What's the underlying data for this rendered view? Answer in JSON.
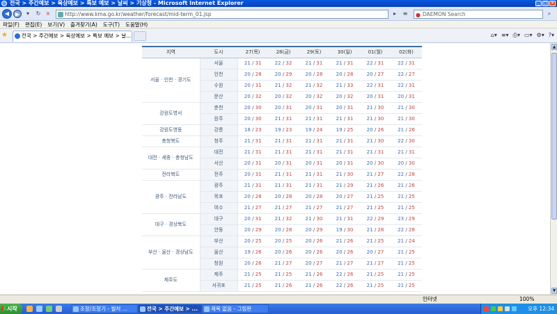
{
  "window": {
    "title": "전국 > 주간예보 > 육상예보 > 특보 예보 > 날씨 > 기상청 - Microsoft Internet Explorer"
  },
  "address": {
    "url": "http://www.kma.go.kr/weather/forecast/mid-term_01.jsp",
    "search_placeholder": "DAEMON Search"
  },
  "menu": [
    "파일(F)",
    "편집(E)",
    "보기(V)",
    "즐겨찾기(A)",
    "도구(T)",
    "도움말(H)"
  ],
  "tab": {
    "title": "전국 > 주간예보 > 육상예보 > 특보 예보 > 날..."
  },
  "table": {
    "headers": [
      "지역",
      "도시",
      "27(목)",
      "28(금)",
      "29(토)",
      "30(일)",
      "01(월)",
      "02(화)"
    ],
    "groups": [
      {
        "region": "서울 · 인천 · 경기도",
        "rows": [
          {
            "city": "서울",
            "temps": [
              [
                "21",
                "31"
              ],
              [
                "22",
                "32"
              ],
              [
                "21",
                "31"
              ],
              [
                "21",
                "31"
              ],
              [
                "22",
                "31"
              ],
              [
                "22",
                "31"
              ]
            ]
          },
          {
            "city": "인천",
            "temps": [
              [
                "20",
                "28"
              ],
              [
                "20",
                "29"
              ],
              [
                "20",
                "28"
              ],
              [
                "20",
                "28"
              ],
              [
                "20",
                "27"
              ],
              [
                "22",
                "27"
              ]
            ]
          },
          {
            "city": "수원",
            "temps": [
              [
                "20",
                "31"
              ],
              [
                "21",
                "32"
              ],
              [
                "21",
                "32"
              ],
              [
                "21",
                "33"
              ],
              [
                "22",
                "31"
              ],
              [
                "22",
                "31"
              ]
            ]
          },
          {
            "city": "문산",
            "temps": [
              [
                "20",
                "32"
              ],
              [
                "20",
                "32"
              ],
              [
                "20",
                "32"
              ],
              [
                "20",
                "32"
              ],
              [
                "20",
                "31"
              ],
              [
                "20",
                "31"
              ]
            ]
          }
        ]
      },
      {
        "region": "강원도영서",
        "rows": [
          {
            "city": "춘천",
            "temps": [
              [
                "20",
                "30"
              ],
              [
                "20",
                "31"
              ],
              [
                "20",
                "31"
              ],
              [
                "20",
                "31"
              ],
              [
                "21",
                "30"
              ],
              [
                "21",
                "30"
              ]
            ]
          },
          {
            "city": "원주",
            "temps": [
              [
                "20",
                "30"
              ],
              [
                "21",
                "31"
              ],
              [
                "21",
                "31"
              ],
              [
                "21",
                "31"
              ],
              [
                "21",
                "30"
              ],
              [
                "21",
                "30"
              ]
            ]
          }
        ]
      },
      {
        "region": "강원도영동",
        "rows": [
          {
            "city": "강릉",
            "temps": [
              [
                "18",
                "23"
              ],
              [
                "19",
                "23"
              ],
              [
                "19",
                "24"
              ],
              [
                "19",
                "25"
              ],
              [
                "20",
                "26"
              ],
              [
                "21",
                "26"
              ]
            ]
          }
        ]
      },
      {
        "region": "충청북도",
        "rows": [
          {
            "city": "청주",
            "temps": [
              [
                "21",
                "31"
              ],
              [
                "21",
                "31"
              ],
              [
                "21",
                "31"
              ],
              [
                "21",
                "31"
              ],
              [
                "21",
                "30"
              ],
              [
                "22",
                "30"
              ]
            ]
          }
        ]
      },
      {
        "region": "대전 · 세종 · 충청남도",
        "rows": [
          {
            "city": "대전",
            "temps": [
              [
                "21",
                "31"
              ],
              [
                "21",
                "31"
              ],
              [
                "21",
                "31"
              ],
              [
                "21",
                "31"
              ],
              [
                "21",
                "31"
              ],
              [
                "21",
                "31"
              ]
            ]
          },
          {
            "city": "서산",
            "temps": [
              [
                "20",
                "31"
              ],
              [
                "20",
                "31"
              ],
              [
                "20",
                "31"
              ],
              [
                "20",
                "31"
              ],
              [
                "20",
                "30"
              ],
              [
                "20",
                "30"
              ]
            ]
          }
        ]
      },
      {
        "region": "전라북도",
        "rows": [
          {
            "city": "전주",
            "temps": [
              [
                "20",
                "31"
              ],
              [
                "21",
                "31"
              ],
              [
                "21",
                "31"
              ],
              [
                "21",
                "30"
              ],
              [
                "21",
                "27"
              ],
              [
                "22",
                "28"
              ]
            ]
          }
        ]
      },
      {
        "region": "광주 · 전라남도",
        "rows": [
          {
            "city": "광주",
            "temps": [
              [
                "21",
                "31"
              ],
              [
                "21",
                "31"
              ],
              [
                "21",
                "31"
              ],
              [
                "21",
                "29"
              ],
              [
                "21",
                "26"
              ],
              [
                "21",
                "26"
              ]
            ]
          },
          {
            "city": "목포",
            "temps": [
              [
                "20",
                "28"
              ],
              [
                "20",
                "28"
              ],
              [
                "20",
                "28"
              ],
              [
                "20",
                "27"
              ],
              [
                "21",
                "25"
              ],
              [
                "21",
                "25"
              ]
            ]
          },
          {
            "city": "여수",
            "temps": [
              [
                "21",
                "27"
              ],
              [
                "21",
                "27"
              ],
              [
                "21",
                "27"
              ],
              [
                "21",
                "27"
              ],
              [
                "21",
                "25"
              ],
              [
                "21",
                "25"
              ]
            ]
          }
        ]
      },
      {
        "region": "대구 · 경상북도",
        "rows": [
          {
            "city": "대구",
            "temps": [
              [
                "20",
                "31"
              ],
              [
                "21",
                "32"
              ],
              [
                "21",
                "30"
              ],
              [
                "21",
                "31"
              ],
              [
                "22",
                "29"
              ],
              [
                "23",
                "29"
              ]
            ]
          },
          {
            "city": "안동",
            "temps": [
              [
                "20",
                "29"
              ],
              [
                "20",
                "28"
              ],
              [
                "20",
                "29"
              ],
              [
                "19",
                "30"
              ],
              [
                "21",
                "28"
              ],
              [
                "22",
                "28"
              ]
            ]
          }
        ]
      },
      {
        "region": "부산 · 울산 · 경상남도",
        "rows": [
          {
            "city": "부산",
            "temps": [
              [
                "20",
                "25"
              ],
              [
                "20",
                "25"
              ],
              [
                "20",
                "26"
              ],
              [
                "21",
                "26"
              ],
              [
                "21",
                "25"
              ],
              [
                "21",
                "24"
              ]
            ]
          },
          {
            "city": "울산",
            "temps": [
              [
                "19",
                "26"
              ],
              [
                "20",
                "26"
              ],
              [
                "20",
                "26"
              ],
              [
                "20",
                "26"
              ],
              [
                "20",
                "27"
              ],
              [
                "21",
                "25"
              ]
            ]
          },
          {
            "city": "창원",
            "temps": [
              [
                "20",
                "26"
              ],
              [
                "21",
                "27"
              ],
              [
                "20",
                "27"
              ],
              [
                "21",
                "27"
              ],
              [
                "21",
                "27"
              ],
              [
                "21",
                "25"
              ]
            ]
          }
        ]
      },
      {
        "region": "제주도",
        "rows": [
          {
            "city": "제주",
            "temps": [
              [
                "21",
                "25"
              ],
              [
                "21",
                "25"
              ],
              [
                "21",
                "26"
              ],
              [
                "22",
                "26"
              ],
              [
                "21",
                "25"
              ],
              [
                "21",
                "25"
              ]
            ]
          },
          {
            "city": "서귀포",
            "temps": [
              [
                "21",
                "25"
              ],
              [
                "21",
                "26"
              ],
              [
                "21",
                "26"
              ],
              [
                "22",
                "26"
              ],
              [
                "21",
                "25"
              ],
              [
                "21",
                "25"
              ]
            ]
          }
        ]
      }
    ]
  },
  "status": {
    "zone": "인터넷",
    "zoom": "100%"
  },
  "taskbar": {
    "start": "시작",
    "items": [
      {
        "label": "조항/조항기 - 월처 ...",
        "active": false
      },
      {
        "label": "전국 > 주간예보 > ...",
        "active": true
      },
      {
        "label": "제목 없음 - 그림판",
        "active": false
      }
    ],
    "clock": "오후 12:34"
  },
  "colors": {
    "low_temp": "#3b6bb0",
    "high_temp": "#c24040",
    "header_border": "#3d6d9e"
  }
}
